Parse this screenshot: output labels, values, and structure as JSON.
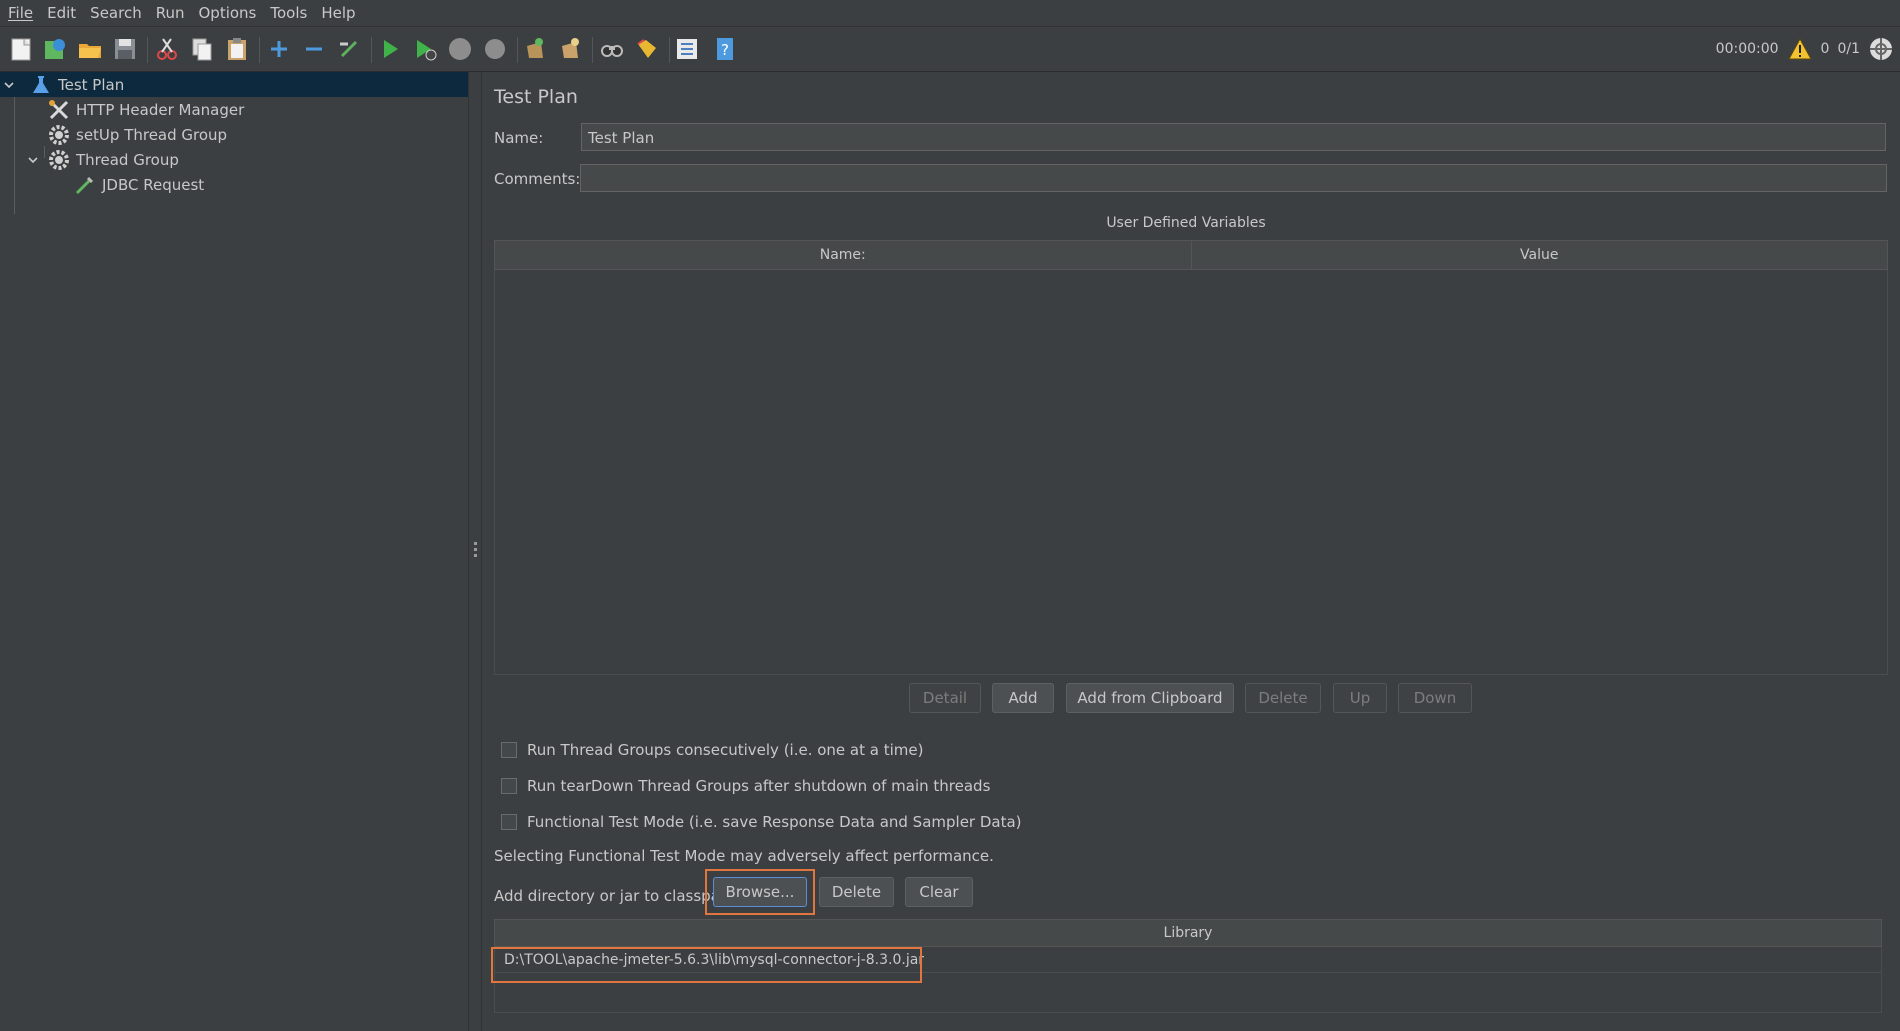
{
  "menu": [
    "File",
    "Edit",
    "Search",
    "Run",
    "Options",
    "Tools",
    "Help"
  ],
  "toolbar": {
    "timer": "00:00:00",
    "warnings": "0",
    "threads": "0/1",
    "icons": [
      "new-icon",
      "templates-icon",
      "open-icon",
      "save-icon",
      "cut-icon",
      "copy-icon",
      "paste-icon",
      "expand-icon",
      "collapse-icon",
      "toggle-icon",
      "start-icon",
      "start-no-pause-icon",
      "stop-icon",
      "shutdown-icon",
      "clear-icon",
      "clear-all-icon",
      "search-icon",
      "reset-search-icon",
      "function-helper-icon",
      "help-icon"
    ]
  },
  "tree": {
    "items": [
      {
        "label": "Test Plan",
        "icon": "flask-icon"
      },
      {
        "label": "HTTP Header Manager",
        "icon": "tools-icon"
      },
      {
        "label": "setUp Thread Group",
        "icon": "gear-icon"
      },
      {
        "label": "Thread Group",
        "icon": "gear-icon"
      },
      {
        "label": "JDBC Request",
        "icon": "pipette-icon"
      }
    ]
  },
  "panel": {
    "title": "Test Plan",
    "name_label": "Name:",
    "name_value": "Test Plan",
    "comments_label": "Comments:",
    "comments_value": "",
    "udv_title": "User Defined Variables",
    "udv_columns": [
      "Name:",
      "Value"
    ],
    "buttons": {
      "detail": "Detail",
      "add": "Add",
      "add_clipboard": "Add from Clipboard",
      "delete": "Delete",
      "up": "Up",
      "down": "Down"
    },
    "checkboxes": [
      "Run Thread Groups consecutively (i.e. one at a time)",
      "Run tearDown Thread Groups after shutdown of main threads",
      "Functional Test Mode (i.e. save Response Data and Sampler Data)"
    ],
    "functional_note": "Selecting Functional Test Mode may adversely affect performance.",
    "classpath_label": "Add directory or jar to classpath",
    "classpath_buttons": {
      "browse": "Browse...",
      "delete": "Delete",
      "clear": "Clear"
    },
    "library_header": "Library",
    "library_rows": [
      "D:\\TOOL\\apache-jmeter-5.6.3\\lib\\mysql-connector-j-8.3.0.jar"
    ]
  },
  "colors": {
    "background": "#3c3f41",
    "selection": "#0d293e",
    "highlight_box": "#e2763f"
  }
}
